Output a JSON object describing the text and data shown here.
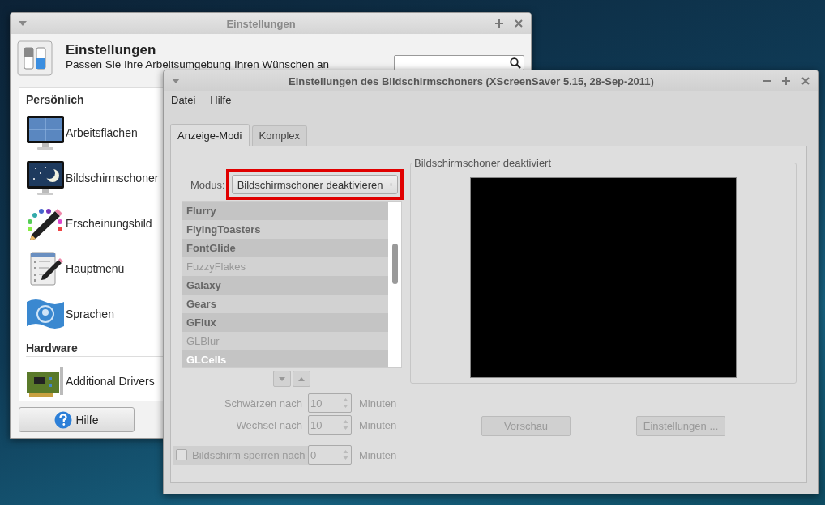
{
  "settings_window": {
    "title": "Einstellungen",
    "active": false,
    "heading": "Einstellungen",
    "subtitle": "Passen Sie Ihre Arbeitsumgebung Ihren Wünschen an",
    "categories": [
      {
        "title": "Persönlich",
        "items": [
          {
            "label": "Arbeitsflächen",
            "kind": "workspaces"
          },
          {
            "label": "Bildschirmschoner",
            "kind": "screensaver"
          },
          {
            "label": "Erscheinungsbild",
            "kind": "appearance"
          },
          {
            "label": "Hauptmenü",
            "kind": "menu"
          },
          {
            "label": "Sprachen",
            "kind": "language"
          }
        ]
      },
      {
        "title": "Hardware",
        "items": [
          {
            "label": "Additional Drivers",
            "kind": "drivers"
          }
        ]
      }
    ],
    "help_button": "Hilfe"
  },
  "screensaver_window": {
    "title": "Einstellungen des Bildschirmschoners  (XScreenSaver 5.15, 28-Sep-2011)",
    "active": true,
    "menu": [
      "Datei",
      "Hilfe"
    ],
    "tabs": [
      {
        "label": "Anzeige-Modi",
        "selected": true
      },
      {
        "label": "Komplex",
        "selected": false
      }
    ],
    "mode": {
      "label": "Modus:",
      "value": "Bildschirmschoner deaktivieren",
      "highlighted": true
    },
    "modes": [
      {
        "name": "Flurry",
        "enabled": true,
        "selected": false
      },
      {
        "name": "FlyingToasters",
        "enabled": true,
        "selected": false
      },
      {
        "name": "FontGlide",
        "enabled": true,
        "selected": false
      },
      {
        "name": "FuzzyFlakes",
        "enabled": false,
        "selected": false
      },
      {
        "name": "Galaxy",
        "enabled": true,
        "selected": false
      },
      {
        "name": "Gears",
        "enabled": true,
        "selected": false
      },
      {
        "name": "GFlux",
        "enabled": true,
        "selected": false
      },
      {
        "name": "GLBlur",
        "enabled": false,
        "selected": false
      },
      {
        "name": "GLCells",
        "enabled": true,
        "selected": true
      }
    ],
    "timers": [
      {
        "label": "Schwärzen nach",
        "value": "10",
        "unit": "Minuten"
      },
      {
        "label": "Wechsel nach",
        "value": "10",
        "unit": "Minuten"
      }
    ],
    "lock": {
      "label": "Bildschirm sperren nach",
      "checked": false,
      "value": "0",
      "unit": "Minuten"
    },
    "preview": {
      "title": "Bildschirmschoner deaktiviert"
    },
    "buttons": [
      "Vorschau",
      "Einstellungen ..."
    ]
  }
}
